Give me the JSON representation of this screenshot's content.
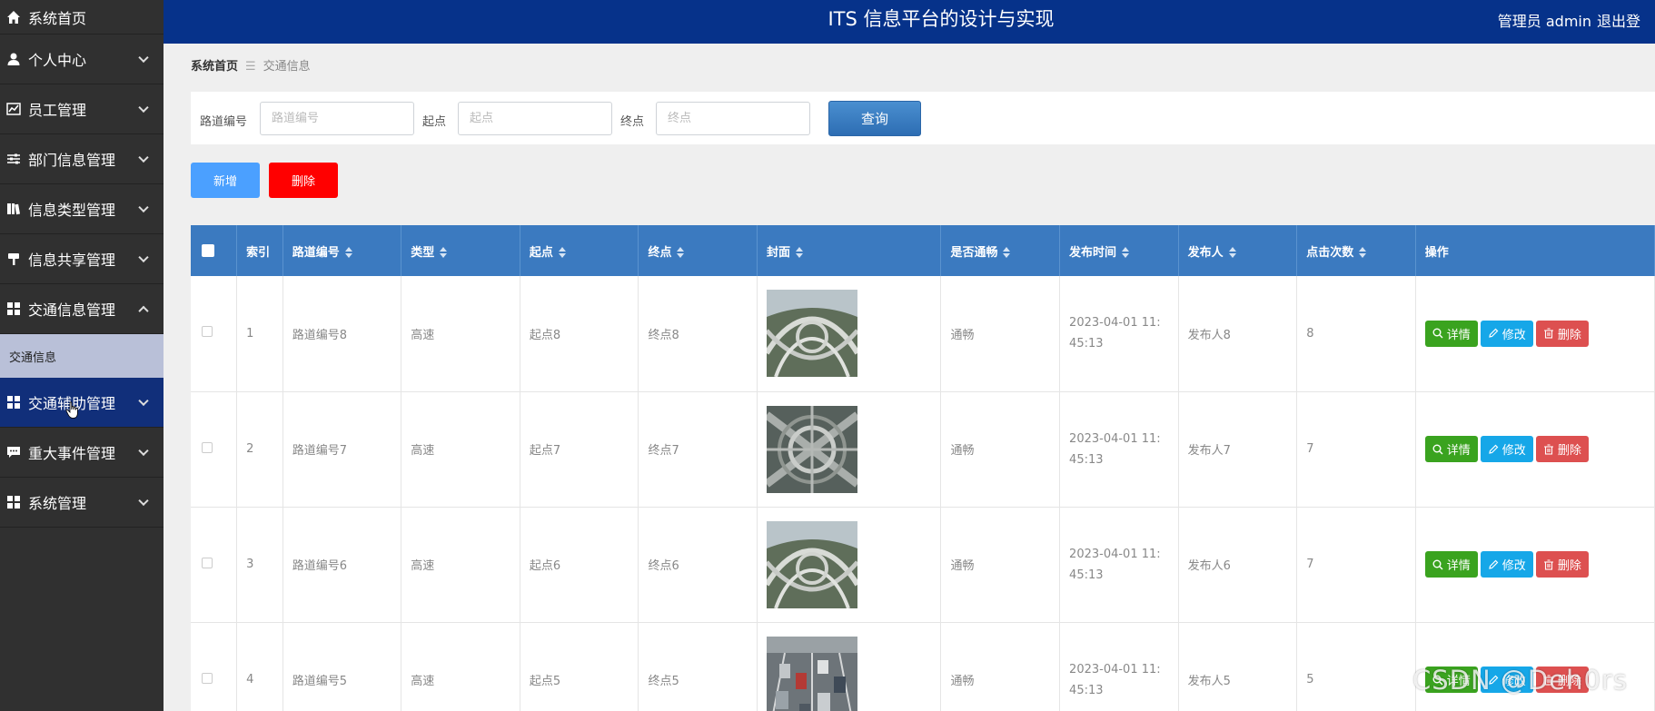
{
  "header": {
    "title": "ITS 信息平台的设计与实现",
    "user": "管理员 admin",
    "logout": "退出登"
  },
  "sidebar": {
    "items": [
      {
        "label": "系统首页",
        "icon": "home-icon"
      },
      {
        "label": "个人中心",
        "icon": "user-icon"
      },
      {
        "label": "员工管理",
        "icon": "chart-icon"
      },
      {
        "label": "部门信息管理",
        "icon": "sliders-icon"
      },
      {
        "label": "信息类型管理",
        "icon": "book-icon"
      },
      {
        "label": "信息共享管理",
        "icon": "signpost-icon"
      },
      {
        "label": "交通信息管理",
        "icon": "grid-icon"
      },
      {
        "label": "交通辅助管理",
        "icon": "grid-icon"
      },
      {
        "label": "重大事件管理",
        "icon": "message-icon"
      },
      {
        "label": "系统管理",
        "icon": "grid-icon"
      }
    ],
    "submenu": {
      "label": "交通信息"
    }
  },
  "breadcrumb": {
    "home": "系统首页",
    "current": "交通信息"
  },
  "search": {
    "fields": [
      {
        "label": "路道编号",
        "placeholder": "路道编号"
      },
      {
        "label": "起点",
        "placeholder": "起点"
      },
      {
        "label": "终点",
        "placeholder": "终点"
      }
    ],
    "query_label": "查询"
  },
  "toolbar": {
    "add_label": "新增",
    "delete_label": "删除"
  },
  "table": {
    "columns": [
      "索引",
      "路道编号",
      "类型",
      "起点",
      "终点",
      "封面",
      "是否通畅",
      "发布时间",
      "发布人",
      "点击次数",
      "操作"
    ],
    "rows": [
      {
        "index": "1",
        "code": "路道编号8",
        "type": "高速",
        "start": "起点8",
        "end": "终点8",
        "status": "通畅",
        "time_date": "2023-04-01 11:",
        "time_clock": "45:13",
        "publisher": "发布人8",
        "clicks": "8"
      },
      {
        "index": "2",
        "code": "路道编号7",
        "type": "高速",
        "start": "起点7",
        "end": "终点7",
        "status": "通畅",
        "time_date": "2023-04-01 11:",
        "time_clock": "45:13",
        "publisher": "发布人7",
        "clicks": "7"
      },
      {
        "index": "3",
        "code": "路道编号6",
        "type": "高速",
        "start": "起点6",
        "end": "终点6",
        "status": "通畅",
        "time_date": "2023-04-01 11:",
        "time_clock": "45:13",
        "publisher": "发布人6",
        "clicks": "7"
      },
      {
        "index": "4",
        "code": "路道编号5",
        "type": "高速",
        "start": "起点5",
        "end": "终点5",
        "status": "通畅",
        "time_date": "2023-04-01 11:",
        "time_clock": "45:13",
        "publisher": "发布人5",
        "clicks": "5"
      }
    ],
    "actions": {
      "detail": "详情",
      "edit": "修改",
      "delete": "删除"
    }
  },
  "watermark": "CSDN @Deh0rs",
  "colors": {
    "sidebar_bg": "#303030",
    "header_bg": "#06328a",
    "table_header": "#3b7ac0",
    "detail": "#3aa31f",
    "edit": "#16a7e8",
    "remove": "#dd5050",
    "add": "#4ba0ff",
    "delete": "#ff0000"
  }
}
